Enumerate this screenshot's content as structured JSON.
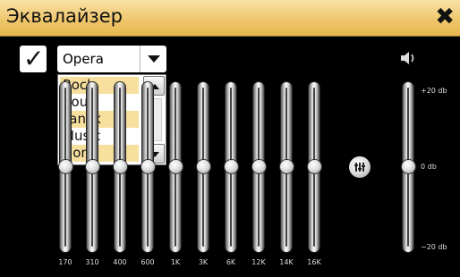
{
  "window": {
    "title": "Эквалайзер",
    "close_glyph": "✖"
  },
  "checkbox": {
    "checked_glyph": "✓"
  },
  "preset": {
    "selected": "Opera",
    "options": [
      {
        "label": "Rock",
        "highlighted": true
      },
      {
        "label": "Soul",
        "highlighted": false
      },
      {
        "label": "Fanck",
        "highlighted": true
      },
      {
        "label": "Music",
        "highlighted": false
      },
      {
        "label": "None",
        "highlighted": true
      }
    ]
  },
  "bands": [
    {
      "label": "170",
      "level_db": 0
    },
    {
      "label": "310",
      "level_db": 0
    },
    {
      "label": "400",
      "level_db": 0
    },
    {
      "label": "600",
      "level_db": 0
    },
    {
      "label": "1K",
      "level_db": 0
    },
    {
      "label": "3K",
      "level_db": 0
    },
    {
      "label": "6K",
      "level_db": 0
    },
    {
      "label": "12K",
      "level_db": 0
    },
    {
      "label": "14K",
      "level_db": 0
    },
    {
      "label": "16K",
      "level_db": 0
    }
  ],
  "volume": {
    "labels": {
      "max": "+20 db",
      "mid": "0 db",
      "min": "−20 db"
    },
    "level_db": 0
  },
  "icons": {
    "close": "close-icon",
    "check": "check-icon",
    "dropdown_arrow": "chevron-down-icon",
    "scroll_up": "arrow-up-icon",
    "scroll_down": "arrow-down-icon",
    "equalizer_reset": "equalizer-icon",
    "speaker": "speaker-icon"
  },
  "colors": {
    "title_bar": "#efc66d",
    "highlight": "#f7df9e",
    "background": "#000000"
  }
}
